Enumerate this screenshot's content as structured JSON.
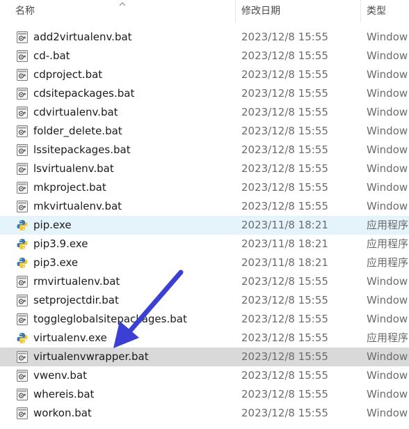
{
  "columns": {
    "name": "名称",
    "date": "修改日期",
    "type": "类型"
  },
  "accent": {
    "arrow": "#3b3fd4",
    "hover": "#e5f3fb",
    "selected": "#d9d9d9"
  },
  "files": [
    {
      "name": "add2virtualenv.bat",
      "date": "2023/12/8 15:55",
      "type": "Window",
      "icon": "bat-file-icon"
    },
    {
      "name": "cd-.bat",
      "date": "2023/12/8 15:55",
      "type": "Window",
      "icon": "bat-file-icon"
    },
    {
      "name": "cdproject.bat",
      "date": "2023/12/8 15:55",
      "type": "Window",
      "icon": "bat-file-icon"
    },
    {
      "name": "cdsitepackages.bat",
      "date": "2023/12/8 15:55",
      "type": "Window",
      "icon": "bat-file-icon"
    },
    {
      "name": "cdvirtualenv.bat",
      "date": "2023/12/8 15:55",
      "type": "Window",
      "icon": "bat-file-icon"
    },
    {
      "name": "folder_delete.bat",
      "date": "2023/12/8 15:55",
      "type": "Window",
      "icon": "bat-file-icon"
    },
    {
      "name": "lssitepackages.bat",
      "date": "2023/12/8 15:55",
      "type": "Window",
      "icon": "bat-file-icon"
    },
    {
      "name": "lsvirtualenv.bat",
      "date": "2023/12/8 15:55",
      "type": "Window",
      "icon": "bat-file-icon"
    },
    {
      "name": "mkproject.bat",
      "date": "2023/12/8 15:55",
      "type": "Window",
      "icon": "bat-file-icon"
    },
    {
      "name": "mkvirtualenv.bat",
      "date": "2023/12/8 15:55",
      "type": "Window",
      "icon": "bat-file-icon"
    },
    {
      "name": "pip.exe",
      "date": "2023/11/8 18:21",
      "type": "应用程序",
      "icon": "python-exe-icon",
      "state": "hover"
    },
    {
      "name": "pip3.9.exe",
      "date": "2023/11/8 18:21",
      "type": "应用程序",
      "icon": "python-exe-icon"
    },
    {
      "name": "pip3.exe",
      "date": "2023/11/8 18:21",
      "type": "应用程序",
      "icon": "python-exe-icon"
    },
    {
      "name": "rmvirtualenv.bat",
      "date": "2023/12/8 15:55",
      "type": "Window",
      "icon": "bat-file-icon"
    },
    {
      "name": "setprojectdir.bat",
      "date": "2023/12/8 15:55",
      "type": "Window",
      "icon": "bat-file-icon"
    },
    {
      "name": "toggleglobalsitepackages.bat",
      "date": "2023/12/8 15:55",
      "type": "Window",
      "icon": "bat-file-icon"
    },
    {
      "name": "virtualenv.exe",
      "date": "2023/12/8 15:55",
      "type": "应用程序",
      "icon": "python-exe-icon"
    },
    {
      "name": "virtualenvwrapper.bat",
      "date": "2023/12/8 15:55",
      "type": "Window",
      "icon": "bat-file-icon",
      "state": "selected"
    },
    {
      "name": "vwenv.bat",
      "date": "2023/12/8 15:55",
      "type": "Window",
      "icon": "bat-file-icon"
    },
    {
      "name": "whereis.bat",
      "date": "2023/12/8 15:55",
      "type": "Window",
      "icon": "bat-file-icon"
    },
    {
      "name": "workon.bat",
      "date": "2023/12/8 15:55",
      "type": "Window",
      "icon": "bat-file-icon"
    }
  ]
}
